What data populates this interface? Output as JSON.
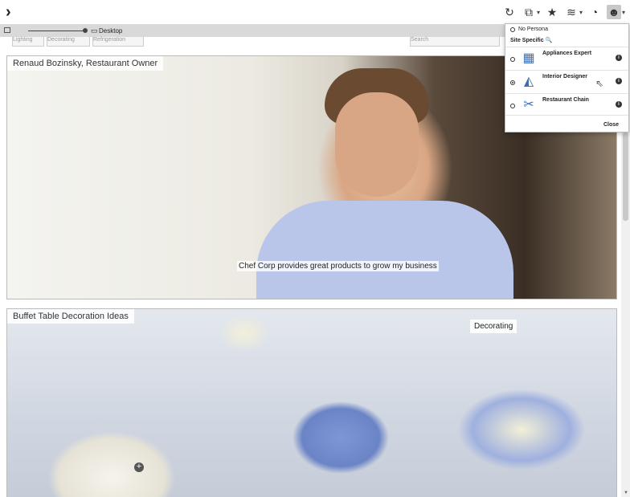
{
  "toolbar": {
    "expand_glyph": "›",
    "icons": [
      {
        "name": "refresh-icon",
        "glyph": "↻"
      },
      {
        "name": "external-link-icon",
        "glyph": "⧉"
      },
      {
        "name": "star-icon",
        "glyph": "★"
      },
      {
        "name": "analytics-icon",
        "glyph": "≋"
      },
      {
        "name": "history-icon",
        "glyph": "◔"
      },
      {
        "name": "persona-icon",
        "glyph": "☻"
      }
    ]
  },
  "subbar": {
    "device_label": "Desktop",
    "device_icon": "▭"
  },
  "filters": [
    "Lighting",
    "Decorating",
    "Refrigeration",
    "Search"
  ],
  "hero": {
    "caption": "Renaud Bozinsky, Restaurant Owner",
    "tagline": "Chef Corp provides great products to grow my business"
  },
  "decor": {
    "caption": "Buffet Table Decoration Ideas",
    "tag": "Decorating",
    "add_glyph": "+"
  },
  "persona_panel": {
    "no_persona": "No Persona",
    "site_specific": "Site Specific",
    "search_icon": "🔍",
    "items": [
      {
        "name": "Appliances Expert",
        "selected": false,
        "icon": "▦"
      },
      {
        "name": "Interior Designer",
        "selected": true,
        "icon": "◭"
      },
      {
        "name": "Restaurant Chain",
        "selected": false,
        "icon": "✂"
      }
    ],
    "info_glyph": "i",
    "close_label": "Close"
  },
  "cursor": "⇖"
}
